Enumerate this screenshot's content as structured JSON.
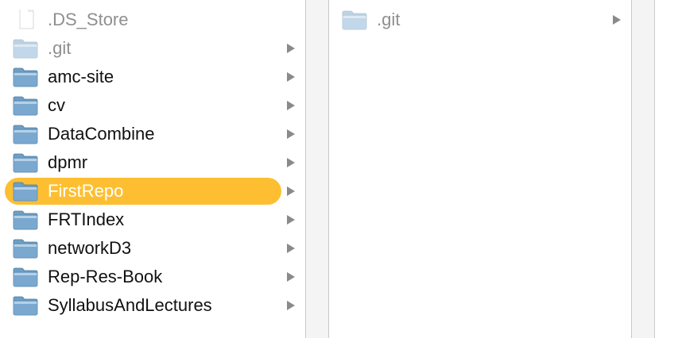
{
  "column1": {
    "items": [
      {
        "label": ".DS_Store",
        "kind": "file",
        "icon": "document-icon",
        "has_children": false,
        "dim": true,
        "selected": false
      },
      {
        "label": ".git",
        "kind": "folder",
        "icon": "folder-icon",
        "has_children": true,
        "dim": true,
        "selected": false
      },
      {
        "label": "amc-site",
        "kind": "folder",
        "icon": "folder-icon",
        "has_children": true,
        "dim": false,
        "selected": false
      },
      {
        "label": "cv",
        "kind": "folder",
        "icon": "folder-icon",
        "has_children": true,
        "dim": false,
        "selected": false
      },
      {
        "label": "DataCombine",
        "kind": "folder",
        "icon": "folder-icon",
        "has_children": true,
        "dim": false,
        "selected": false
      },
      {
        "label": "dpmr",
        "kind": "folder",
        "icon": "folder-icon",
        "has_children": true,
        "dim": false,
        "selected": false
      },
      {
        "label": "FirstRepo",
        "kind": "folder",
        "icon": "folder-icon",
        "has_children": true,
        "dim": false,
        "selected": true
      },
      {
        "label": "FRTIndex",
        "kind": "folder",
        "icon": "folder-icon",
        "has_children": true,
        "dim": false,
        "selected": false
      },
      {
        "label": "networkD3",
        "kind": "folder",
        "icon": "folder-icon",
        "has_children": true,
        "dim": false,
        "selected": false
      },
      {
        "label": "Rep-Res-Book",
        "kind": "folder",
        "icon": "folder-icon",
        "has_children": true,
        "dim": false,
        "selected": false
      },
      {
        "label": "SyllabusAndLectures",
        "kind": "folder",
        "icon": "folder-icon",
        "has_children": true,
        "dim": false,
        "selected": false
      }
    ]
  },
  "column2": {
    "items": [
      {
        "label": ".git",
        "kind": "folder",
        "icon": "folder-icon",
        "has_children": true,
        "dim": true,
        "selected": false
      }
    ]
  },
  "colors": {
    "selection": "#fdbf31",
    "text": "#111111",
    "dim_text": "#8f8f8f",
    "separator": "#f4f4f4",
    "arrow": "#8a8a8a",
    "arrow_selected": "#8a8a8a"
  }
}
